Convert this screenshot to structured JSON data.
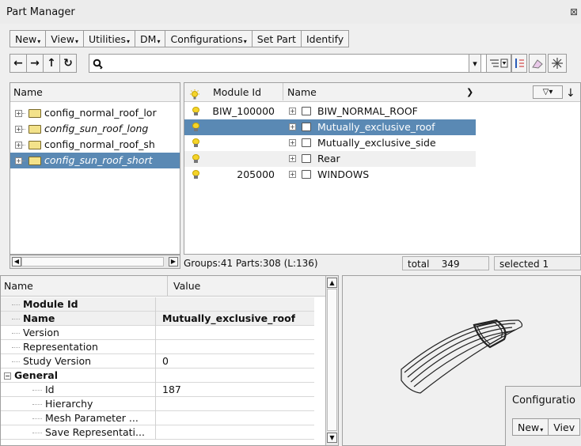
{
  "window": {
    "title": "Part Manager",
    "close_glyph": "⊠"
  },
  "menubar": [
    {
      "label": "New",
      "dropdown": true
    },
    {
      "label": "View",
      "dropdown": true
    },
    {
      "label": "Utilities",
      "dropdown": true
    },
    {
      "label": "DM",
      "dropdown": true
    },
    {
      "label": "Configurations",
      "dropdown": true
    },
    {
      "label": "Set Part",
      "dropdown": false
    },
    {
      "label": "Identify",
      "dropdown": false
    }
  ],
  "nav": {
    "back_glyph": "←",
    "forward_glyph": "→",
    "up_glyph": "↑",
    "refresh_glyph": "↻",
    "search_value": "",
    "search_icon_glyph": "🔍︎"
  },
  "config_tree": {
    "header": "Name",
    "items": [
      {
        "label": "config_normal_roof_lor",
        "italic": false,
        "selected": false
      },
      {
        "label": "config_sun_roof_long",
        "italic": true,
        "selected": false
      },
      {
        "label": "config_normal_roof_sh",
        "italic": false,
        "selected": false
      },
      {
        "label": "config_sun_roof_short",
        "italic": true,
        "selected": true
      }
    ]
  },
  "parts_tree": {
    "headers": {
      "module_id": "Module Id",
      "name": "Name"
    },
    "rows": [
      {
        "module_id": "BIW_100000",
        "name": "BIW_NORMAL_ROOF",
        "selected": false
      },
      {
        "module_id": "",
        "name": "Mutually_exclusive_roof",
        "selected": true
      },
      {
        "module_id": "",
        "name": "Mutually_exclusive_side",
        "selected": false
      },
      {
        "module_id": "",
        "name": "Rear",
        "selected": false
      },
      {
        "module_id": "205000",
        "name": "WINDOWS",
        "selected": false
      }
    ]
  },
  "status": {
    "groups": "Groups:41 Parts:308 (L:136)",
    "total_label": "total",
    "total_value": "349",
    "selected": "selected 1"
  },
  "properties": {
    "header_name": "Name",
    "header_value": "Value",
    "rows": [
      {
        "name": "Module Id",
        "value": "",
        "bold": true,
        "indent": 1
      },
      {
        "name": "Name",
        "value": "Mutually_exclusive_roof",
        "bold": true,
        "indent": 1
      },
      {
        "name": "Version",
        "value": "",
        "bold": false,
        "indent": 1
      },
      {
        "name": "Representation",
        "value": "",
        "bold": false,
        "indent": 1
      },
      {
        "name": "Study Version",
        "value": "0",
        "bold": false,
        "indent": 1
      },
      {
        "name": "General",
        "value": "",
        "bold": true,
        "indent": 0,
        "expander": "⊟"
      },
      {
        "name": "Id",
        "value": "187",
        "bold": false,
        "indent": 2
      },
      {
        "name": "Hierarchy",
        "value": "",
        "bold": false,
        "indent": 2
      },
      {
        "name": "Mesh Parameter ...",
        "value": "",
        "bold": false,
        "indent": 2
      },
      {
        "name": "Save Representati...",
        "value": "",
        "bold": false,
        "indent": 2
      }
    ]
  },
  "sub_window": {
    "title": "Configuratio",
    "new_label": "New",
    "view_label": "Viev"
  }
}
